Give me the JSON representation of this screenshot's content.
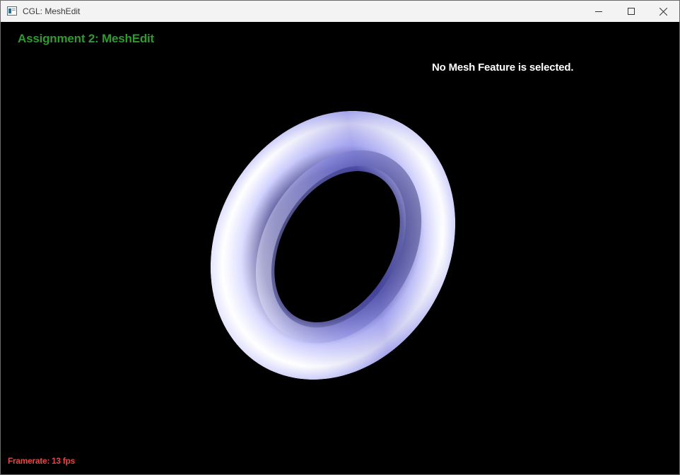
{
  "window": {
    "title": "CGL: MeshEdit",
    "app_icon": "window-app-icon",
    "controls": {
      "minimize_icon": "minimize-icon",
      "maximize_icon": "maximize-icon",
      "close_icon": "close-icon"
    }
  },
  "viewport": {
    "heading": "Assignment 2: MeshEdit",
    "selection_status": "No Mesh Feature is selected.",
    "framerate": "Framerate: 13 fps"
  },
  "colors": {
    "heading": "#2f9b2f",
    "selection_status": "#ffffff",
    "framerate": "#e04848",
    "background": "#000000",
    "mesh_light": "#ffffff",
    "mesh_shade": "#8f8ff5",
    "mesh_dark": "#3a3a86"
  }
}
